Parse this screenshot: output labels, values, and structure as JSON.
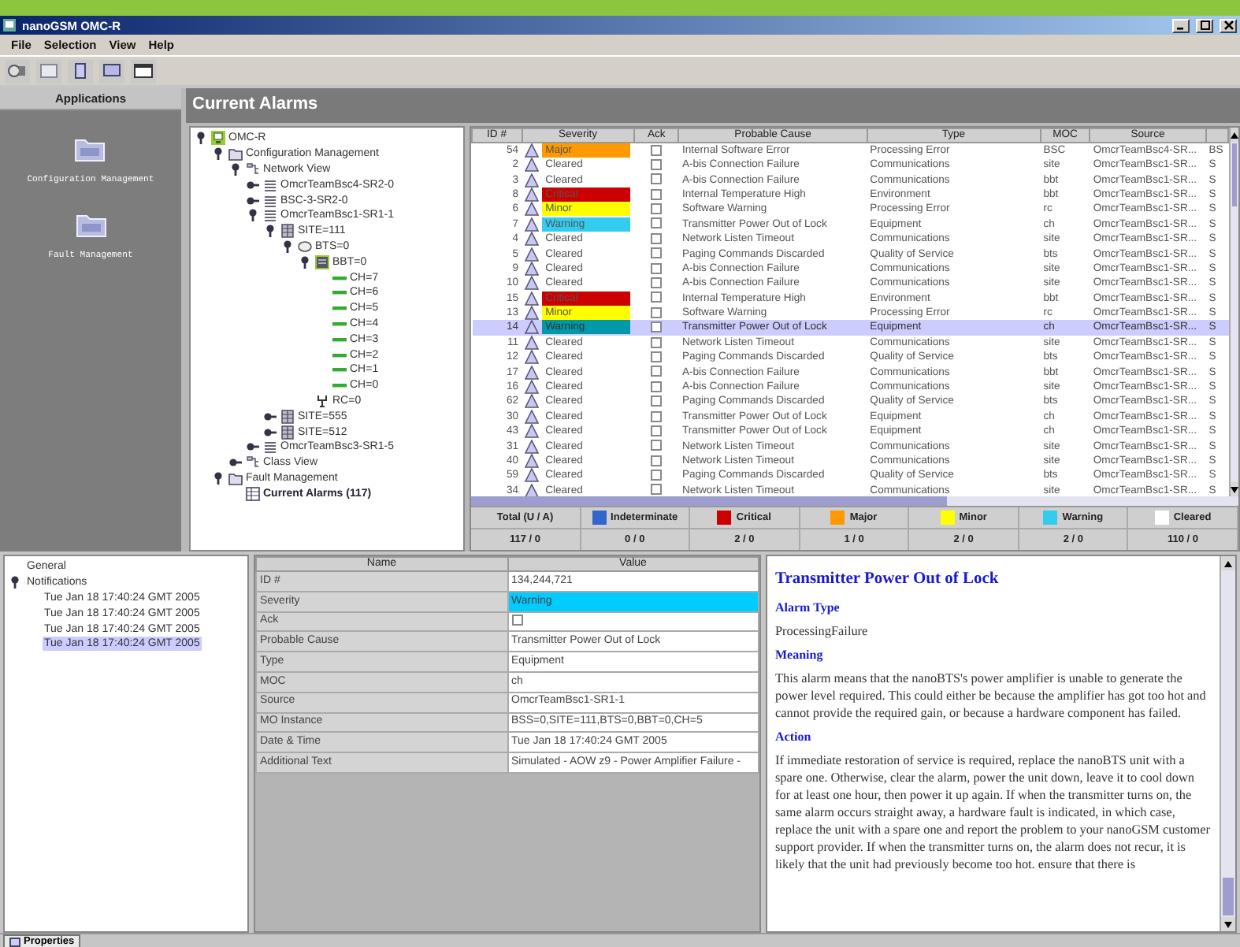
{
  "window": {
    "title": "nanoGSM OMC-R"
  },
  "menu": [
    "File",
    "Selection",
    "View",
    "Help"
  ],
  "applications": {
    "title": "Applications",
    "items": [
      {
        "label": "Configuration Management"
      },
      {
        "label": "Fault Management"
      }
    ]
  },
  "alarms_panel": {
    "title": "Current Alarms"
  },
  "tree": [
    {
      "label": "OMC-R",
      "kind": "root",
      "expanded": true,
      "children": [
        {
          "label": "Configuration Management",
          "kind": "folder",
          "expanded": true,
          "children": [
            {
              "label": "Network View",
              "kind": "network",
              "expanded": true,
              "children": [
                {
                  "label": "OmcrTeamBsc4-SR2-0",
                  "kind": "bsc",
                  "expanded": false
                },
                {
                  "label": "BSC-3-SR2-0",
                  "kind": "bsc",
                  "expanded": false
                },
                {
                  "label": "OmcrTeamBsc1-SR1-1",
                  "kind": "bsc",
                  "expanded": true,
                  "children": [
                    {
                      "label": "SITE=111",
                      "kind": "site",
                      "expanded": true,
                      "children": [
                        {
                          "label": "BTS=0",
                          "kind": "bts",
                          "expanded": true,
                          "children": [
                            {
                              "label": "BBT=0",
                              "kind": "bbt",
                              "expanded": true,
                              "children": [
                                {
                                  "label": "CH=7",
                                  "kind": "ch"
                                },
                                {
                                  "label": "CH=6",
                                  "kind": "ch"
                                },
                                {
                                  "label": "CH=5",
                                  "kind": "ch"
                                },
                                {
                                  "label": "CH=4",
                                  "kind": "ch"
                                },
                                {
                                  "label": "CH=3",
                                  "kind": "ch"
                                },
                                {
                                  "label": "CH=2",
                                  "kind": "ch"
                                },
                                {
                                  "label": "CH=1",
                                  "kind": "ch"
                                },
                                {
                                  "label": "CH=0",
                                  "kind": "ch"
                                }
                              ]
                            },
                            {
                              "label": "RC=0",
                              "kind": "rc"
                            }
                          ]
                        }
                      ]
                    },
                    {
                      "label": "SITE=555",
                      "kind": "site",
                      "expanded": false
                    },
                    {
                      "label": "SITE=512",
                      "kind": "site",
                      "expanded": false
                    }
                  ]
                },
                {
                  "label": "OmcrTeamBsc3-SR1-5",
                  "kind": "bsc",
                  "expanded": false
                }
              ]
            },
            {
              "label": "Class View",
              "kind": "network",
              "expanded": false
            }
          ]
        },
        {
          "label": "Fault Management",
          "kind": "folder",
          "expanded": true,
          "children": [
            {
              "label": "Current Alarms (117)",
              "kind": "alarms"
            }
          ]
        }
      ]
    }
  ],
  "table": {
    "columns": [
      "ID #",
      "Severity",
      "Ack",
      "Probable Cause",
      "Type",
      "MOC",
      "Source"
    ],
    "rows": [
      {
        "id": "54",
        "severity": "Major",
        "color": "#ff9900",
        "ack": false,
        "cause": "Internal Software Error",
        "type": "Processing Error",
        "moc": "BSC",
        "source": "OmcrTeamBsc4-SR...",
        "column_8": "BS",
        "selected": false
      },
      {
        "id": "2",
        "severity": "Cleared",
        "ack": false,
        "cause": "A-bis Connection Failure",
        "type": "Communications",
        "moc": "site",
        "source": "OmcrTeamBsc1-SR...",
        "column_8": "S",
        "selected": false
      },
      {
        "id": "3",
        "severity": "Cleared",
        "ack": false,
        "cause": "A-bis Connection Failure",
        "type": "Communications",
        "moc": "bbt",
        "source": "OmcrTeamBsc1-SR...",
        "column_8": "S",
        "selected": false
      },
      {
        "id": "8",
        "severity": "Critical",
        "color": "#cc0000",
        "ack": false,
        "cause": "Internal Temperature High",
        "type": "Environment",
        "moc": "bbt",
        "source": "OmcrTeamBsc1-SR...",
        "column_8": "S",
        "selected": false
      },
      {
        "id": "6",
        "severity": "Minor",
        "color": "#ffff00",
        "ack": false,
        "cause": "Software Warning",
        "type": "Processing Error",
        "moc": "rc",
        "source": "OmcrTeamBsc1-SR...",
        "column_8": "S",
        "selected": false
      },
      {
        "id": "7",
        "severity": "Warning",
        "color": "#33ccee",
        "ack": false,
        "cause": "Transmitter Power Out of Lock",
        "type": "Equipment",
        "moc": "ch",
        "source": "OmcrTeamBsc1-SR...",
        "column_8": "S",
        "selected": false
      },
      {
        "id": "4",
        "severity": "Cleared",
        "ack": false,
        "cause": "Network Listen Timeout",
        "type": "Communications",
        "moc": "site",
        "source": "OmcrTeamBsc1-SR...",
        "column_8": "S",
        "selected": false
      },
      {
        "id": "5",
        "severity": "Cleared",
        "ack": false,
        "cause": "Paging Commands Discarded",
        "type": "Quality of Service",
        "moc": "bts",
        "source": "OmcrTeamBsc1-SR...",
        "column_8": "S",
        "selected": false
      },
      {
        "id": "9",
        "severity": "Cleared",
        "ack": false,
        "cause": "A-bis Connection Failure",
        "type": "Communications",
        "moc": "site",
        "source": "OmcrTeamBsc1-SR...",
        "column_8": "S",
        "selected": false
      },
      {
        "id": "10",
        "severity": "Cleared",
        "ack": false,
        "cause": "A-bis Connection Failure",
        "type": "Communications",
        "moc": "site",
        "source": "OmcrTeamBsc1-SR...",
        "column_8": "S",
        "selected": false
      },
      {
        "id": "15",
        "severity": "Critical",
        "color": "#cc0000",
        "ack": false,
        "cause": "Internal Temperature High",
        "type": "Environment",
        "moc": "bbt",
        "source": "OmcrTeamBsc1-SR...",
        "column_8": "S",
        "selected": false
      },
      {
        "id": "13",
        "severity": "Minor",
        "color": "#ffff00",
        "ack": false,
        "cause": "Software Warning",
        "type": "Processing Error",
        "moc": "rc",
        "source": "OmcrTeamBsc1-SR...",
        "column_8": "S",
        "selected": false
      },
      {
        "id": "14",
        "severity": "Warning",
        "color": "#0099aa",
        "ack": false,
        "cause": "Transmitter Power Out of Lock",
        "type": "Equipment",
        "moc": "ch",
        "source": "OmcrTeamBsc1-SR...",
        "column_8": "S",
        "selected": true
      },
      {
        "id": "11",
        "severity": "Cleared",
        "ack": false,
        "cause": "Network Listen Timeout",
        "type": "Communications",
        "moc": "site",
        "source": "OmcrTeamBsc1-SR...",
        "column_8": "S",
        "selected": false
      },
      {
        "id": "12",
        "severity": "Cleared",
        "ack": false,
        "cause": "Paging Commands Discarded",
        "type": "Quality of Service",
        "moc": "bts",
        "source": "OmcrTeamBsc1-SR...",
        "column_8": "S",
        "selected": false
      },
      {
        "id": "17",
        "severity": "Cleared",
        "ack": false,
        "cause": "A-bis Connection Failure",
        "type": "Communications",
        "moc": "bbt",
        "source": "OmcrTeamBsc1-SR...",
        "column_8": "S",
        "selected": false
      },
      {
        "id": "16",
        "severity": "Cleared",
        "ack": false,
        "cause": "A-bis Connection Failure",
        "type": "Communications",
        "moc": "site",
        "source": "OmcrTeamBsc1-SR...",
        "column_8": "S",
        "selected": false
      },
      {
        "id": "62",
        "severity": "Cleared",
        "ack": false,
        "cause": "Paging Commands Discarded",
        "type": "Quality of Service",
        "moc": "bts",
        "source": "OmcrTeamBsc1-SR...",
        "column_8": "S",
        "selected": false
      },
      {
        "id": "30",
        "severity": "Cleared",
        "ack": false,
        "cause": "Transmitter Power Out of Lock",
        "type": "Equipment",
        "moc": "ch",
        "source": "OmcrTeamBsc1-SR...",
        "column_8": "S",
        "selected": false
      },
      {
        "id": "43",
        "severity": "Cleared",
        "ack": false,
        "cause": "Transmitter Power Out of Lock",
        "type": "Equipment",
        "moc": "ch",
        "source": "OmcrTeamBsc1-SR...",
        "column_8": "S",
        "selected": false
      },
      {
        "id": "31",
        "severity": "Cleared",
        "ack": false,
        "cause": "Network Listen Timeout",
        "type": "Communications",
        "moc": "site",
        "source": "OmcrTeamBsc1-SR...",
        "column_8": "S",
        "selected": false
      },
      {
        "id": "40",
        "severity": "Cleared",
        "ack": false,
        "cause": "Network Listen Timeout",
        "type": "Communications",
        "moc": "site",
        "source": "OmcrTeamBsc1-SR...",
        "column_8": "S",
        "selected": false
      },
      {
        "id": "59",
        "severity": "Cleared",
        "ack": false,
        "cause": "Paging Commands Discarded",
        "type": "Quality of Service",
        "moc": "bts",
        "source": "OmcrTeamBsc1-SR...",
        "column_8": "S",
        "selected": false
      },
      {
        "id": "34",
        "severity": "Cleared",
        "ack": false,
        "cause": "Network Listen Timeout",
        "type": "Communications",
        "moc": "site",
        "source": "OmcrTeamBsc1-SR...",
        "column_8": "S",
        "selected": false
      }
    ]
  },
  "summary": [
    {
      "label": "Total (U / A)",
      "count": "117 / 0"
    },
    {
      "label": "Indeterminate",
      "color": "#3366cc",
      "count": "0 / 0"
    },
    {
      "label": "Critical",
      "color": "#cc0000",
      "count": "2 / 0"
    },
    {
      "label": "Major",
      "color": "#ff9900",
      "count": "1 / 0"
    },
    {
      "label": "Minor",
      "color": "#ffff00",
      "count": "2 / 0"
    },
    {
      "label": "Warning",
      "color": "#33ccee",
      "count": "2 / 0"
    },
    {
      "label": "Cleared",
      "color": "#ffffff",
      "count": "110 / 0"
    }
  ],
  "notifications_tree": [
    {
      "label": "General"
    },
    {
      "label": "Notifications",
      "expanded": true,
      "children": [
        {
          "label": "Tue Jan 18 17:40:24 GMT 2005",
          "selected": false
        },
        {
          "label": "Tue Jan 18 17:40:24 GMT 2005",
          "selected": false
        },
        {
          "label": "Tue Jan 18 17:40:24 GMT 2005",
          "selected": false
        },
        {
          "label": "Tue Jan 18 17:40:24 GMT 2005",
          "selected": true
        }
      ]
    }
  ],
  "properties": {
    "columns": [
      "Name",
      "Value"
    ],
    "rows": [
      {
        "name": "ID #",
        "value": "134,244,721"
      },
      {
        "name": "Severity",
        "kind": "severity",
        "value": "Warning",
        "color": "#00ccff"
      },
      {
        "name": "Ack",
        "kind": "checkbox",
        "checked": false
      },
      {
        "name": "Probable Cause",
        "value": "Transmitter Power Out of Lock"
      },
      {
        "name": "Type",
        "value": "Equipment"
      },
      {
        "name": "MOC",
        "value": "ch"
      },
      {
        "name": "Source",
        "value": "OmcrTeamBsc1-SR1-1"
      },
      {
        "name": "MO Instance",
        "value": "BSS=0,SITE=111,BTS=0,BBT=0,CH=5"
      },
      {
        "name": "Date & Time",
        "value": "Tue Jan 18 17:40:24 GMT 2005"
      },
      {
        "name": "Additional Text",
        "value": "Simulated - AOW z9 - Power Amplifier Failure -"
      }
    ]
  },
  "help": {
    "title": "Transmitter Power Out of Lock",
    "sections": [
      {
        "heading": "Alarm Type",
        "text": "ProcessingFailure"
      },
      {
        "heading": "Meaning",
        "text": "This alarm means that the nanoBTS's power amplifier is unable to generate the power level required. This could either be because the amplifier has got too hot and cannot provide the required gain, or because a hardware component has failed."
      },
      {
        "heading": "Action",
        "text": "If immediate restoration of service is required, replace the nanoBTS unit with a spare one. Otherwise, clear the alarm, power the unit down, leave it to cool down for at least one hour, then power it up again. If when the transmitter turns on, the same alarm occurs straight away, a hardware fault is indicated, in which case, replace the unit with a spare one and report the problem to your nanoGSM customer support provider. If when the transmitter turns on, the alarm does not recur, it is likely that the unit had previously become too hot. ensure that there is"
      }
    ]
  },
  "status_tabs": [
    {
      "label": "Properties",
      "selected": true
    }
  ]
}
